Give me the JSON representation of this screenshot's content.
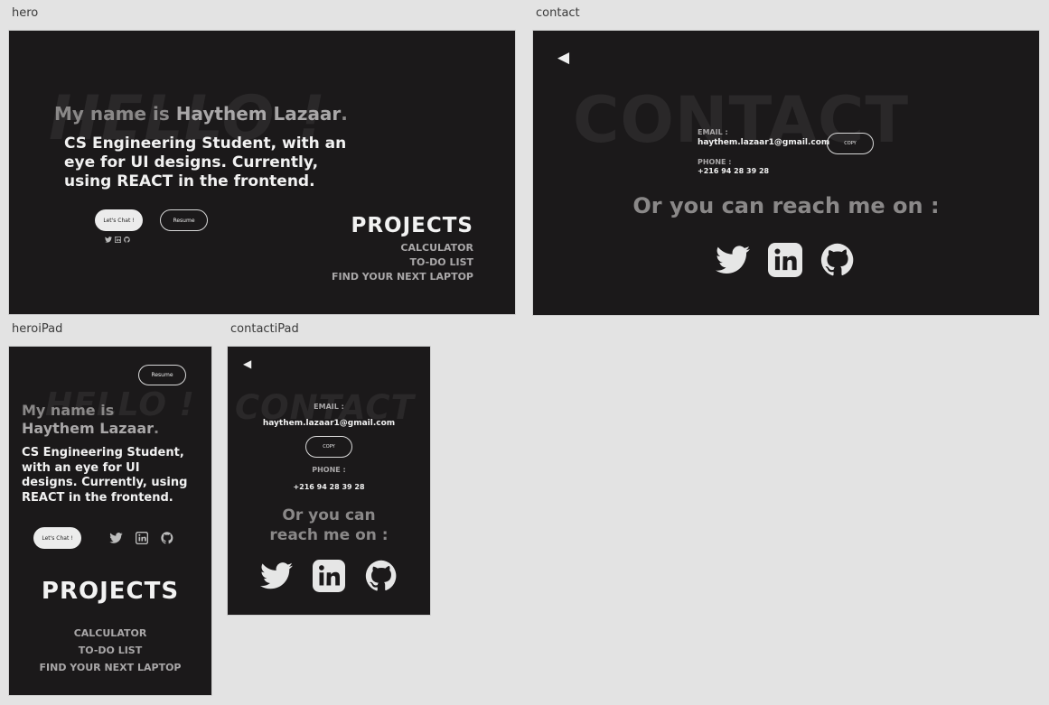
{
  "artboards": {
    "hero": "hero",
    "contact": "contact",
    "heroipad": "heroiPad",
    "contactipad": "contactiPad"
  },
  "hero": {
    "bg_word": "HELLO !",
    "intro_prefix": "My name is ",
    "name": "Haythem Lazaar",
    "intro_suffix": ".",
    "tagline": "CS Engineering Student, with an eye for UI designs. Currently, using REACT in the frontend.",
    "chat_button": "Let's Chat !",
    "resume_button": "Resume",
    "projects_title": "PROJECTS",
    "projects": [
      "CALCULATOR",
      "TO-DO LIST",
      "FIND YOUR NEXT LAPTOP"
    ]
  },
  "contact": {
    "back": "◀",
    "bg_word": "CONTACT",
    "email_label": "EMAIL :",
    "email": "haythem.lazaar1@gmail.com",
    "copy_button": "COPY",
    "phone_label": "PHONE :",
    "phone": "+216 94 28 39 28",
    "reach": "Or you can reach me on :"
  },
  "heroipad": {
    "resume_button": "Resume",
    "bg_word": "HELLO !",
    "intro_prefix": "My name is",
    "name": "Haythem Lazaar",
    "intro_suffix": ".",
    "tagline": "CS Engineering Student, with an eye for UI designs. Currently, using REACT in the frontend.",
    "chat_button": "Let's Chat !",
    "projects_title": "PROJECTS",
    "projects": [
      "CALCULATOR",
      "TO-DO LIST",
      "FIND YOUR NEXT LAPTOP"
    ]
  },
  "contactipad": {
    "back": "◀",
    "bg_word": "CONTACT",
    "email_label": "EMAIL :",
    "email": "haythem.lazaar1@gmail.com",
    "copy_button": "COPY",
    "phone_label": "PHONE :",
    "phone": "+216 94 28 39 28",
    "reach_line1": "Or you can",
    "reach_line2": "reach me on :"
  },
  "icons": [
    "twitter-icon",
    "linkedin-icon",
    "github-icon"
  ],
  "colors": {
    "artboard_bg": "#1b191a",
    "canvas_bg": "#e3e3e3",
    "muted_text": "#8a8888",
    "light_text": "#f1f1f1"
  }
}
